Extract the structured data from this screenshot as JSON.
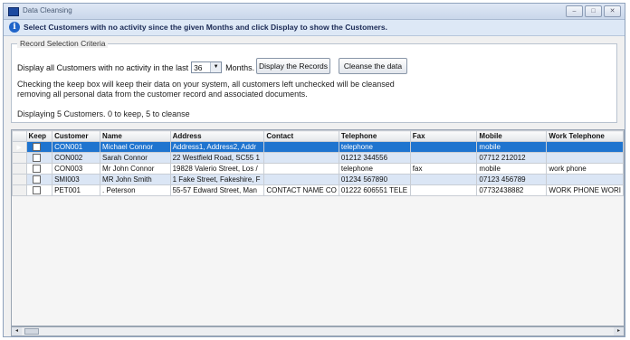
{
  "window": {
    "title": "Data Cleansing",
    "controls": [
      "–",
      "□",
      "✕"
    ]
  },
  "info": {
    "text": "Select Customers with no activity since the given Months and click Display to show the Customers."
  },
  "criteria": {
    "legend": "Record Selection Criteria",
    "prefix": "Display all Customers with no activity in the last",
    "months_value": "36",
    "unit": "Months.",
    "display_button": "Display the Records",
    "cleanse_button": "Cleanse the data",
    "note": "Checking the keep box will keep their data on your system, all customers left unchecked will be cleansed removing all personal data from the customer record and associated documents.",
    "status": "Displaying 5 Customers. 0 to keep, 5 to cleanse"
  },
  "grid": {
    "columns": [
      "Keep",
      "Customer",
      "Name",
      "Address",
      "Contact",
      "Telephone",
      "Fax",
      "Mobile",
      "Work Telephone"
    ],
    "rows": [
      [
        "",
        "CON001",
        "Michael Connor",
        "Address1, Address2, Addr",
        "",
        "telephone",
        "",
        "mobile",
        ""
      ],
      [
        "",
        "CON002",
        "Sarah Connor",
        "22 Westfield Road, SC55 1",
        "",
        "01212 344556",
        "",
        "07712 212012",
        ""
      ],
      [
        "",
        "CON003",
        "Mr John Connor",
        "19828 Valerio Street, Los /",
        "",
        "telephone",
        "fax",
        "mobile",
        "work phone"
      ],
      [
        "",
        "SMI003",
        "MR John Smith",
        "1 Fake Street, Fakeshire, F",
        "",
        "01234 567890",
        "",
        "07123 456789",
        ""
      ],
      [
        "",
        "PET001",
        ". Peterson",
        "55-57 Edward Street, Man",
        "CONTACT NAME CO",
        "01222 606551 TELE",
        "",
        "07732438882",
        "WORK PHONE WORI"
      ]
    ]
  },
  "scrollbar": {
    "left_arrow": "◂",
    "right_arrow": "▸"
  }
}
